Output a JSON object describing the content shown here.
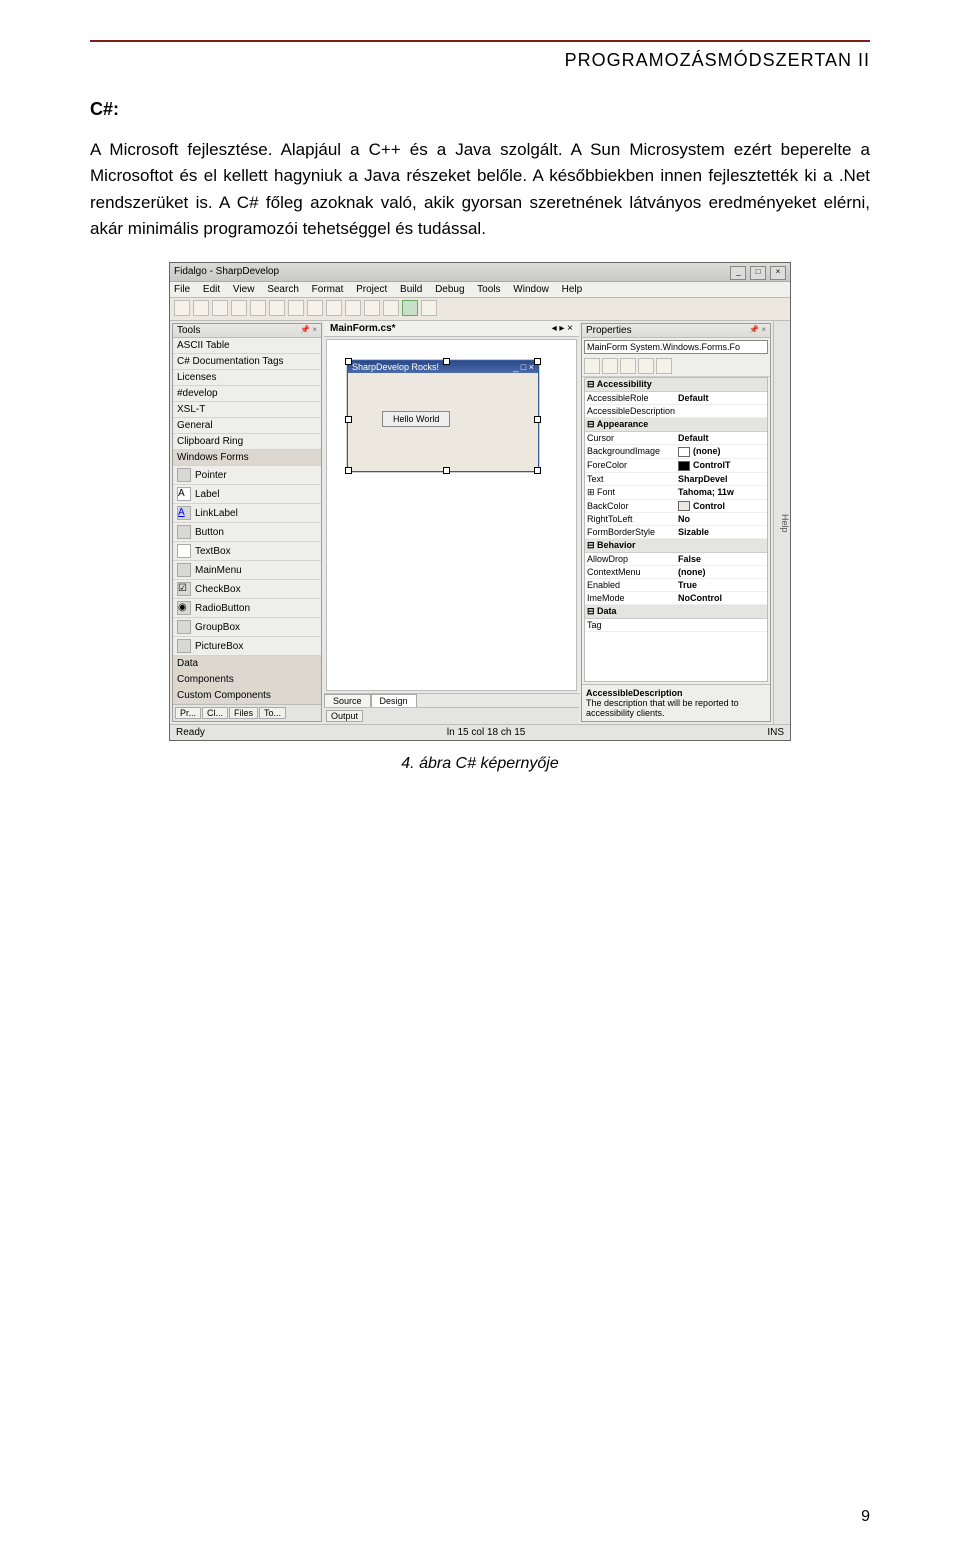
{
  "header": {
    "title": "PROGRAMOZÁSMÓDSZERTAN II"
  },
  "section": {
    "label": "C#:"
  },
  "paragraph": "A Microsoft fejlesztése. Alapjául a C++ és a Java szolgált. A Sun Microsystem ezért beperelte a Microsoftot és el kellett hagyniuk a Java részeket belőle. A későbbiekben innen fejlesztették ki a .Net rendszerüket is. A C# főleg azoknak való, akik gyorsan szeretnének látványos eredményeket elérni, akár minimális programozói tehetséggel és tudással.",
  "figure": {
    "caption": "4. ábra C# képernyője"
  },
  "ide": {
    "title": "Fidalgo - SharpDevelop",
    "menu": [
      "File",
      "Edit",
      "View",
      "Search",
      "Format",
      "Project",
      "Build",
      "Debug",
      "Tools",
      "Window",
      "Help"
    ],
    "tools_panel_title": "Tools",
    "tools_items": [
      "ASCII Table",
      "C# Documentation Tags",
      "Licenses",
      "#develop",
      "XSL-T",
      "General",
      "Clipboard Ring",
      "Windows Forms"
    ],
    "tools_wf": [
      {
        "label": "Pointer"
      },
      {
        "label": "Label"
      },
      {
        "label": "LinkLabel"
      },
      {
        "label": "Button"
      },
      {
        "label": "TextBox"
      },
      {
        "label": "MainMenu"
      },
      {
        "label": "CheckBox"
      },
      {
        "label": "RadioButton"
      },
      {
        "label": "GroupBox"
      },
      {
        "label": "PictureBox"
      }
    ],
    "tools_groups_bottom": [
      "Data",
      "Components",
      "Custom Components"
    ],
    "left_bottom_tabs": [
      "Pr...",
      "Cl...",
      "Files",
      "To..."
    ],
    "doc_tab": "MainForm.cs*",
    "form_title": "SharpDevelop Rocks!",
    "hello_button": "Hello World",
    "view_tabs": [
      "Source",
      "Design"
    ],
    "props_title": "Properties",
    "props_combo": "MainForm  System.Windows.Forms.Fo",
    "prop_groups": [
      {
        "name": "Accessibility",
        "rows": [
          {
            "n": "AccessibleRole",
            "v": "Default"
          },
          {
            "n": "AccessibleDescription",
            "v": ""
          }
        ]
      },
      {
        "name": "Appearance",
        "rows": [
          {
            "n": "Cursor",
            "v": "Default"
          },
          {
            "n": "BackgroundImage",
            "v": "(none)",
            "sw": true
          },
          {
            "n": "ForeColor",
            "v": "ControlT",
            "sw": true
          },
          {
            "n": "Text",
            "v": "SharpDevel"
          },
          {
            "n": "Font",
            "v": "Tahoma; 11w"
          },
          {
            "n": "BackColor",
            "v": "Control",
            "sw": true
          },
          {
            "n": "RightToLeft",
            "v": "No"
          },
          {
            "n": "FormBorderStyle",
            "v": "Sizable"
          }
        ]
      },
      {
        "name": "Behavior",
        "rows": [
          {
            "n": "AllowDrop",
            "v": "False"
          },
          {
            "n": "ContextMenu",
            "v": "(none)"
          },
          {
            "n": "Enabled",
            "v": "True"
          },
          {
            "n": "ImeMode",
            "v": "NoControl"
          }
        ]
      },
      {
        "name": "Data",
        "rows": [
          {
            "n": "Tag",
            "v": ""
          }
        ]
      }
    ],
    "prop_help_title": "AccessibleDescription",
    "prop_help_text": "The description that will be reported to accessibility clients.",
    "output_tab": "Output",
    "status_left": "Ready",
    "status_mid": "ln 15     col 18   ch 15",
    "status_right": "INS",
    "side_tab": "Help"
  },
  "page_number": "9"
}
